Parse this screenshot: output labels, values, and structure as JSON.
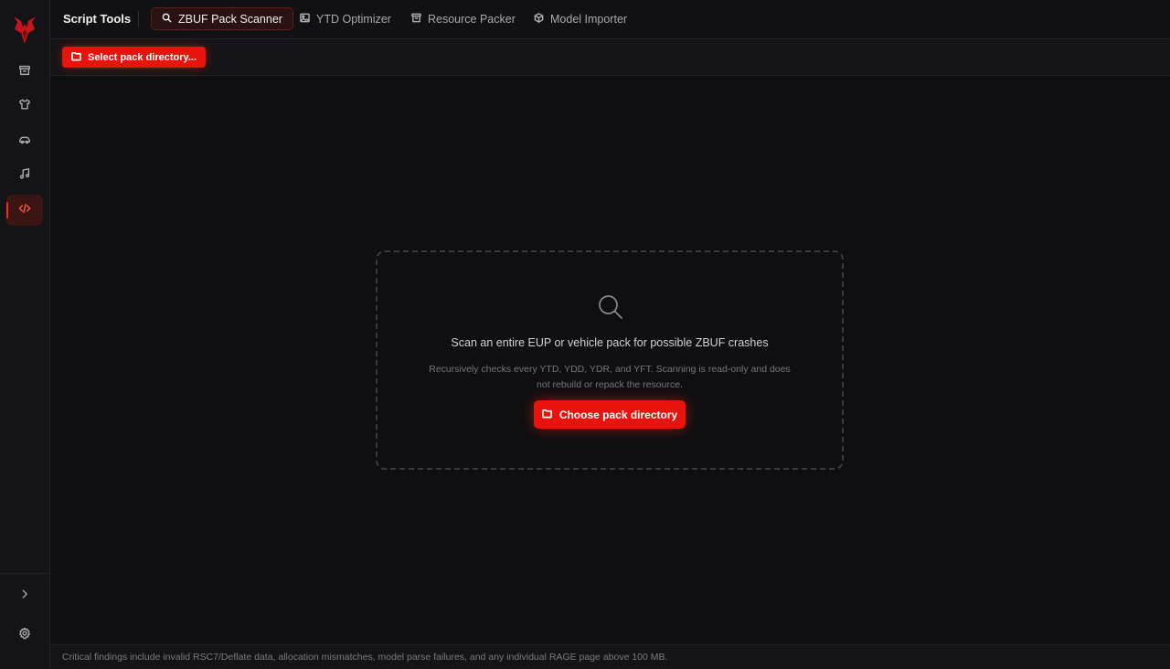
{
  "app": {
    "title": "Script Tools"
  },
  "colors": {
    "accent": "#e8130c",
    "background": "#0f0f11",
    "sidebar": "#141417"
  },
  "sidebar": {
    "logo_icon": "red-wing-logo-icon",
    "items": [
      {
        "name": "archive",
        "icon": "archive-icon",
        "active": false
      },
      {
        "name": "clothing",
        "icon": "shirt-icon",
        "active": false
      },
      {
        "name": "vehicles",
        "icon": "car-icon",
        "active": false
      },
      {
        "name": "audio",
        "icon": "music-note-icon",
        "active": false
      },
      {
        "name": "script-tools",
        "icon": "code-icon",
        "active": true
      }
    ],
    "bottom_items": [
      {
        "name": "expand",
        "icon": "chevron-right-icon"
      },
      {
        "name": "settings",
        "icon": "gear-icon"
      }
    ]
  },
  "tabs": [
    {
      "label": "ZBUF Pack Scanner",
      "icon": "search-icon",
      "active": true
    },
    {
      "label": "YTD Optimizer",
      "icon": "image-icon",
      "active": false
    },
    {
      "label": "Resource Packer",
      "icon": "archive-icon",
      "active": false
    },
    {
      "label": "Model Importer",
      "icon": "cube-icon",
      "active": false
    }
  ],
  "toolbar": {
    "select_label": "Select pack directory..."
  },
  "dropzone": {
    "icon": "search-icon",
    "title": "Scan an entire EUP or vehicle pack for possible ZBUF crashes",
    "description": "Recursively checks every YTD, YDD, YDR, and YFT. Scanning is read-only and does not rebuild or repack the resource.",
    "button_label": "Choose pack directory"
  },
  "footer": {
    "text": "Critical findings include invalid RSC7/Deflate data, allocation mismatches, model parse failures, and any individual RAGE page above 100 MB."
  }
}
